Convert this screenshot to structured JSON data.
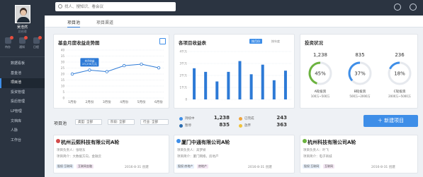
{
  "user": {
    "name": "吴浩然",
    "role": "总经理"
  },
  "quick_links": [
    {
      "label": "待办",
      "icon": "todo-icon",
      "badge": true
    },
    {
      "label": "通知",
      "icon": "bell-icon",
      "badge": true
    },
    {
      "label": "日程",
      "icon": "calendar-icon",
      "badge": true
    }
  ],
  "nav": [
    {
      "label": "数据看板"
    },
    {
      "label": "基金池"
    },
    {
      "label": "项目池",
      "active": true
    },
    {
      "label": "投资管理"
    },
    {
      "label": "投后管理"
    },
    {
      "label": "LP管理"
    },
    {
      "label": "文档库"
    },
    {
      "label": "人脉"
    },
    {
      "label": "工作台"
    }
  ],
  "search": {
    "placeholder": "找人、搜知识、看会议"
  },
  "tabs": [
    {
      "label": "项目池",
      "active": true
    },
    {
      "label": "项目渠道"
    }
  ],
  "cards": {
    "fund_chart": {
      "title": "基金月度收益走势图"
    },
    "project_chart": {
      "title": "各项目收益表",
      "toggle_a": "按月份",
      "toggle_b": "按年度"
    },
    "investment": {
      "title": "投资状况"
    }
  },
  "chart_data": [
    {
      "type": "line",
      "title": "基金月度收益走势图",
      "categories": [
        "1月份",
        "2月份",
        "3月份",
        "4月份",
        "5月份",
        "6月份"
      ],
      "values": [
        20,
        23.3,
        22,
        27,
        28.2,
        25.2
      ],
      "ylim": [
        0,
        40
      ],
      "yticks": [
        0,
        5,
        10,
        15,
        20,
        25,
        30,
        35,
        40
      ],
      "tooltip": {
        "label": "本月收益",
        "value": "23,230万元"
      },
      "color": "#2d7ad6",
      "grid": true
    },
    {
      "type": "bar",
      "title": "各项目收益表",
      "values": [
        2.6,
        2.3,
        1.5,
        2.3,
        3.2,
        2.1,
        2.9,
        1.6,
        2.4
      ],
      "yticks": [
        "0",
        "1千万",
        "2千万",
        "3千万",
        "4千万"
      ],
      "ylim": [
        0,
        4
      ],
      "color": "#2d7ad6",
      "grid": true
    }
  ],
  "investment_gauges": [
    {
      "count": "1,238",
      "percent": 45,
      "percent_label": "45%",
      "label": "A轮投资",
      "range": "100万~500万",
      "color": "#6cb33f"
    },
    {
      "count": "835",
      "percent": 37,
      "percent_label": "37%",
      "label": "B轮投资",
      "range": "500万~2000万",
      "color": "#3e8ee8"
    },
    {
      "count": "236",
      "percent": 18,
      "percent_label": "18%",
      "label": "C轮投资",
      "range": "2000万~5000万",
      "color": "#3e8ee8"
    }
  ],
  "toolbar": {
    "pool_label": "项目池",
    "filters": [
      "类型: 全部",
      "阶段: 全部",
      "行业: 全部"
    ],
    "new_button": "新建项目"
  },
  "stats": [
    {
      "label": "持续中",
      "value": "1,238",
      "color": "#3e8ee8"
    },
    {
      "label": "已完成",
      "value": "243",
      "color": "#f0a33a"
    },
    {
      "label": "暂停",
      "value": "835",
      "color": "#2b6cb0"
    },
    {
      "label": "放弃",
      "value": "363",
      "color": "#f0c33a"
    }
  ],
  "projects": [
    {
      "title": "杭州云熙科技有限公司A轮",
      "owner": "项目负责人：张晓东",
      "desc": "项目简介：大数据方向，金融云",
      "tags": [
        "股权·互联网",
        "互联网金融"
      ],
      "date": "2016-8-31 创建"
    },
    {
      "title": "厦门中通有限公司A轮",
      "owner": "项目负责人：高梦妍",
      "desc": "项目简介：厦门网络，房地产",
      "tags": [
        "股权·房地产",
        "房地产"
      ],
      "date": "2016-8-31 创建"
    },
    {
      "title": "杭州科技有限公司A轮",
      "owner": "项目负责人：叶飞",
      "desc": "项目简介：电子商城",
      "tags": [
        "股权·互联网",
        "互联网"
      ],
      "date": "2016-8-31 创建"
    }
  ]
}
